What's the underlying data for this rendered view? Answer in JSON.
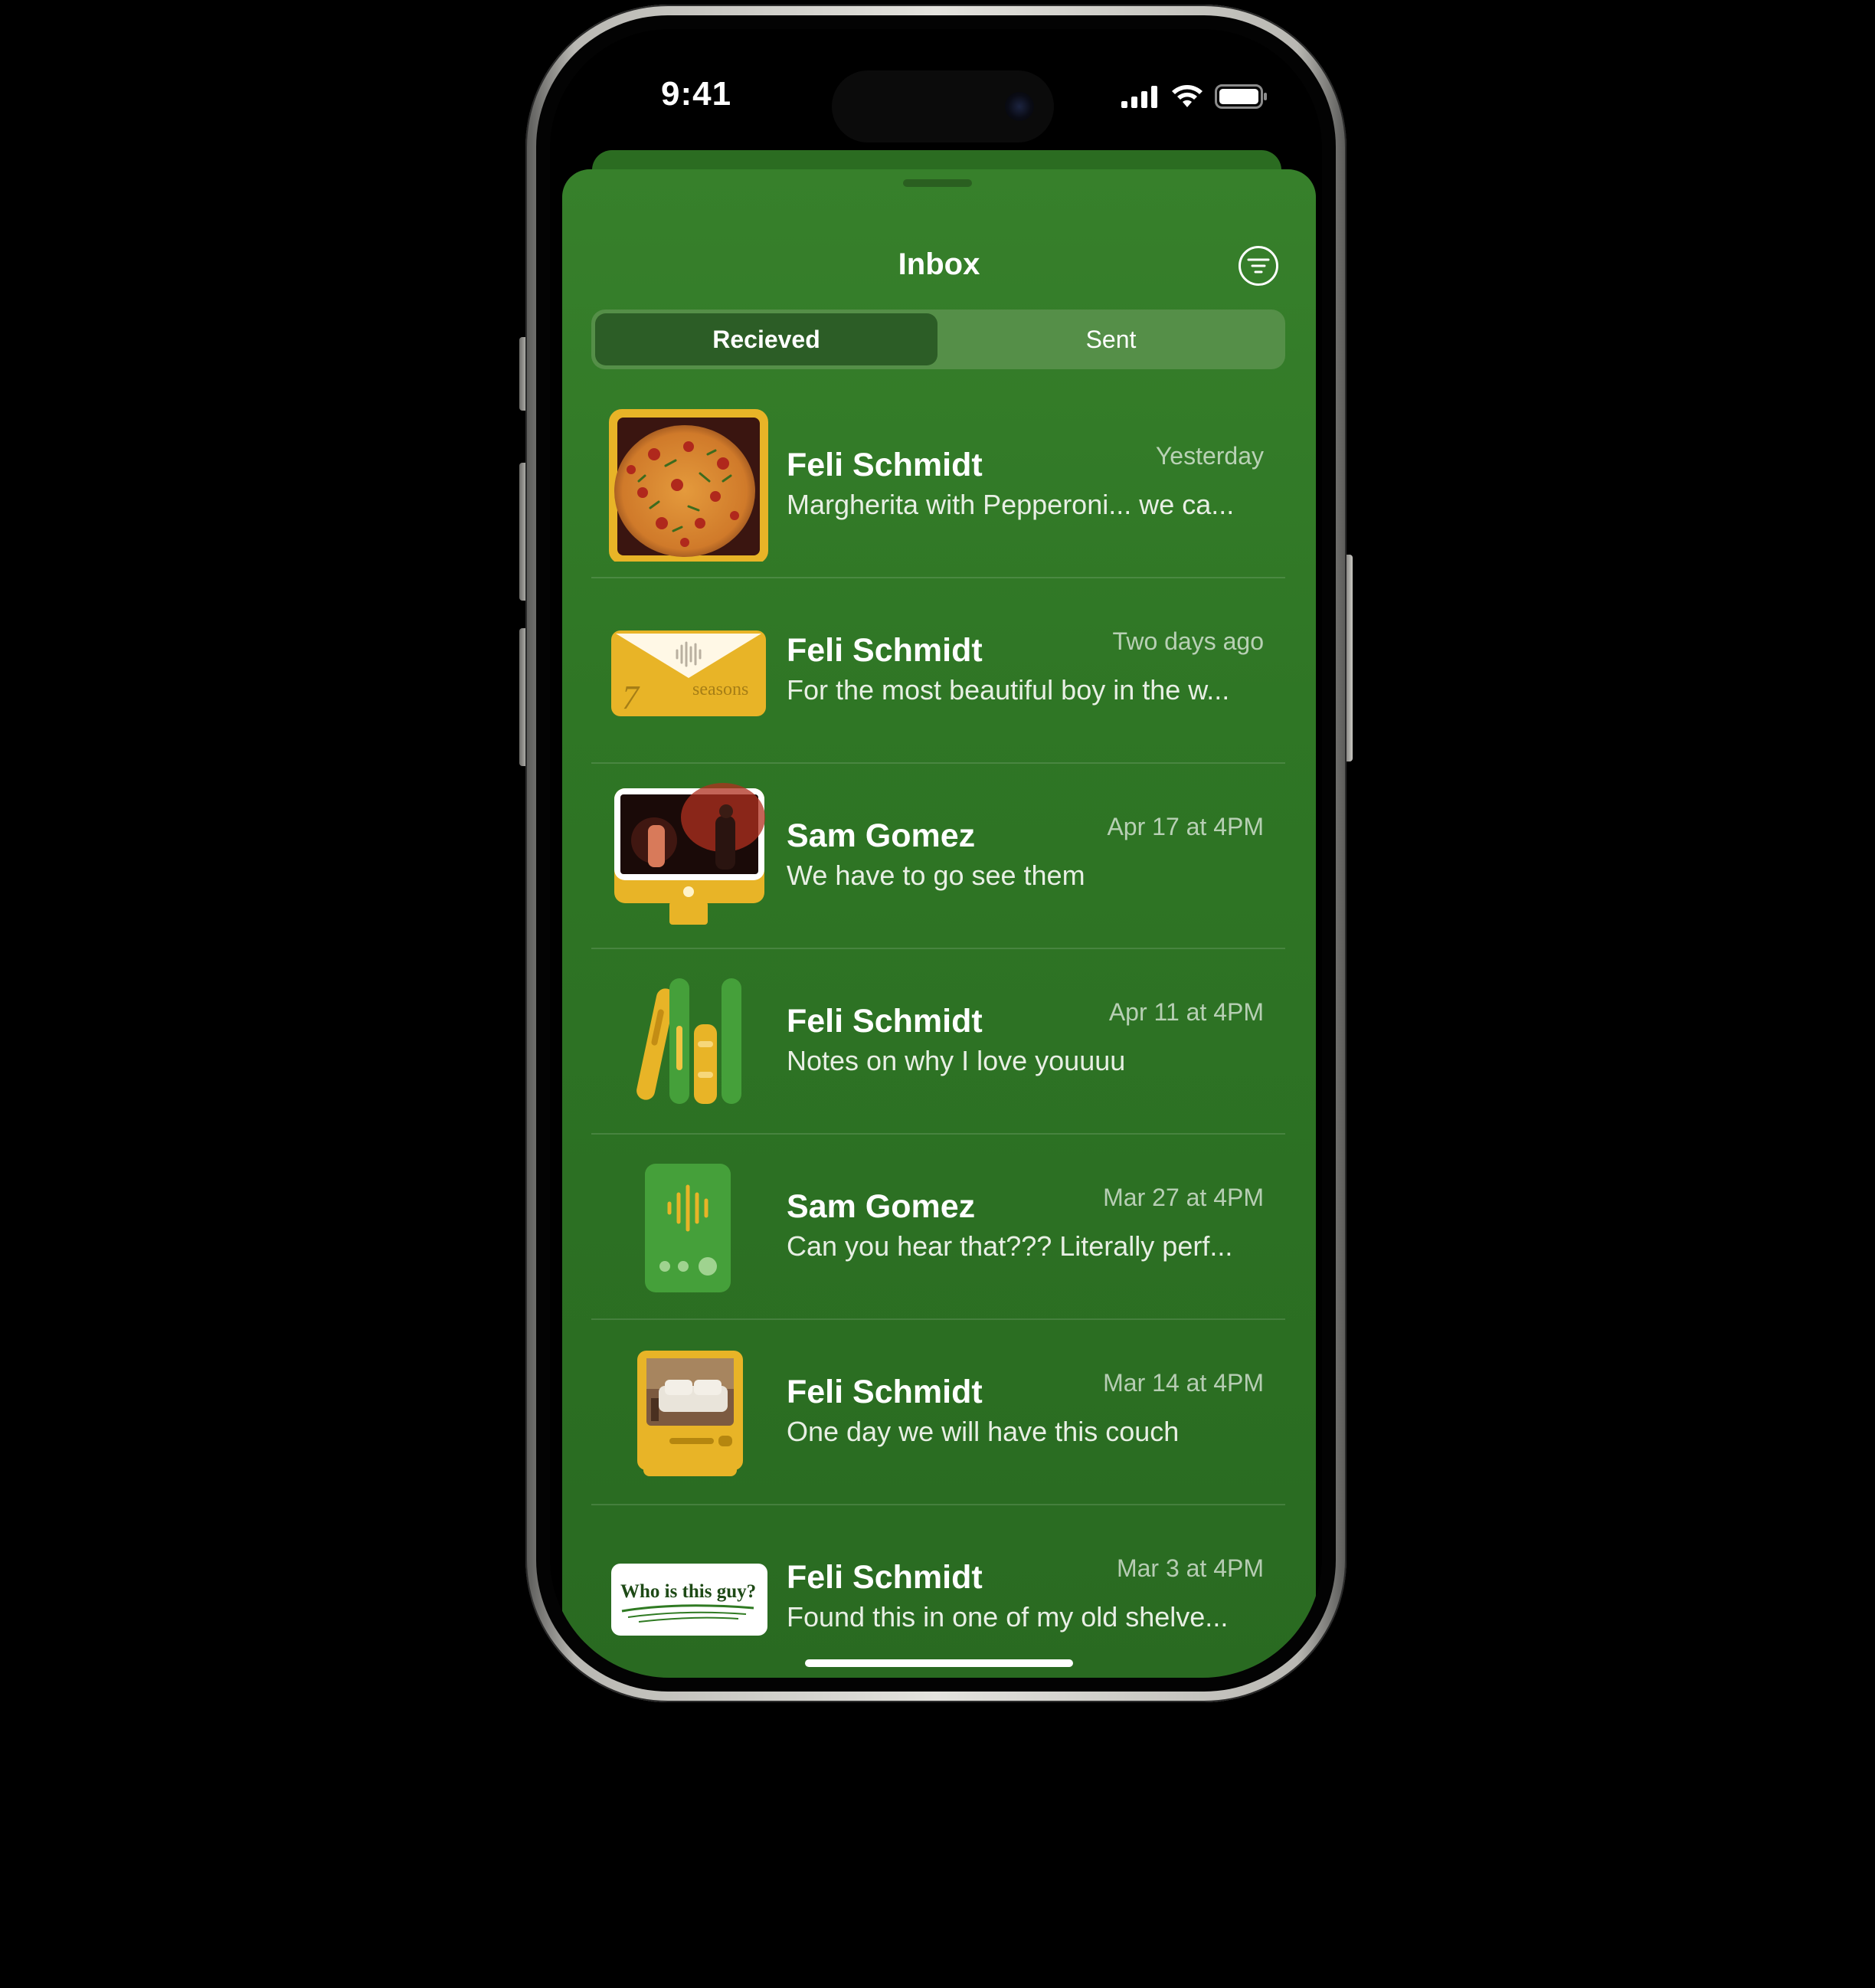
{
  "status_bar": {
    "time": "9:41",
    "icons": [
      "cellular-signal-icon",
      "wifi-icon",
      "battery-icon"
    ]
  },
  "inbox": {
    "title": "Inbox",
    "filter_icon": "filter-icon",
    "tabs": [
      {
        "label": "Recieved",
        "selected": true
      },
      {
        "label": "Sent",
        "selected": false
      }
    ],
    "messages": [
      {
        "sender": "Feli Schmidt",
        "time": "Yesterday",
        "preview": "Margherita with Pepperoni... we ca...",
        "thumbnail": "pizza-photo"
      },
      {
        "sender": "Feli Schmidt",
        "time": "Two days ago",
        "preview": "For the most beautiful boy in the w...",
        "thumbnail": "envelope-audio",
        "thumbnail_text": {
          "number": "7",
          "word": "seasons"
        }
      },
      {
        "sender": "Sam Gomez",
        "time": "Apr 17 at 4PM",
        "preview": "We have to go see them",
        "thumbnail": "concert-video-monitor"
      },
      {
        "sender": "Feli Schmidt",
        "time": "Apr 11 at 4PM",
        "preview": "Notes on why I love youuuu",
        "thumbnail": "books"
      },
      {
        "sender": "Sam Gomez",
        "time": "Mar 27 at 4PM",
        "preview": "Can you hear that??? Literally perf...",
        "thumbnail": "voice-recorder"
      },
      {
        "sender": "Feli Schmidt",
        "time": "Mar 14 at 4PM",
        "preview": "One day we will have this couch",
        "thumbnail": "couch-photo-frame"
      },
      {
        "sender": "Feli Schmidt",
        "time": "Mar 3 at 4PM",
        "preview": "Found this in one of my old shelve...",
        "thumbnail": "handwritten-note",
        "thumbnail_text": "Who is this guy?"
      }
    ]
  },
  "colors": {
    "sheet_green": "#2f7625",
    "accent_yellow": "#e8b427",
    "segment_selected": "#2c5d26"
  }
}
